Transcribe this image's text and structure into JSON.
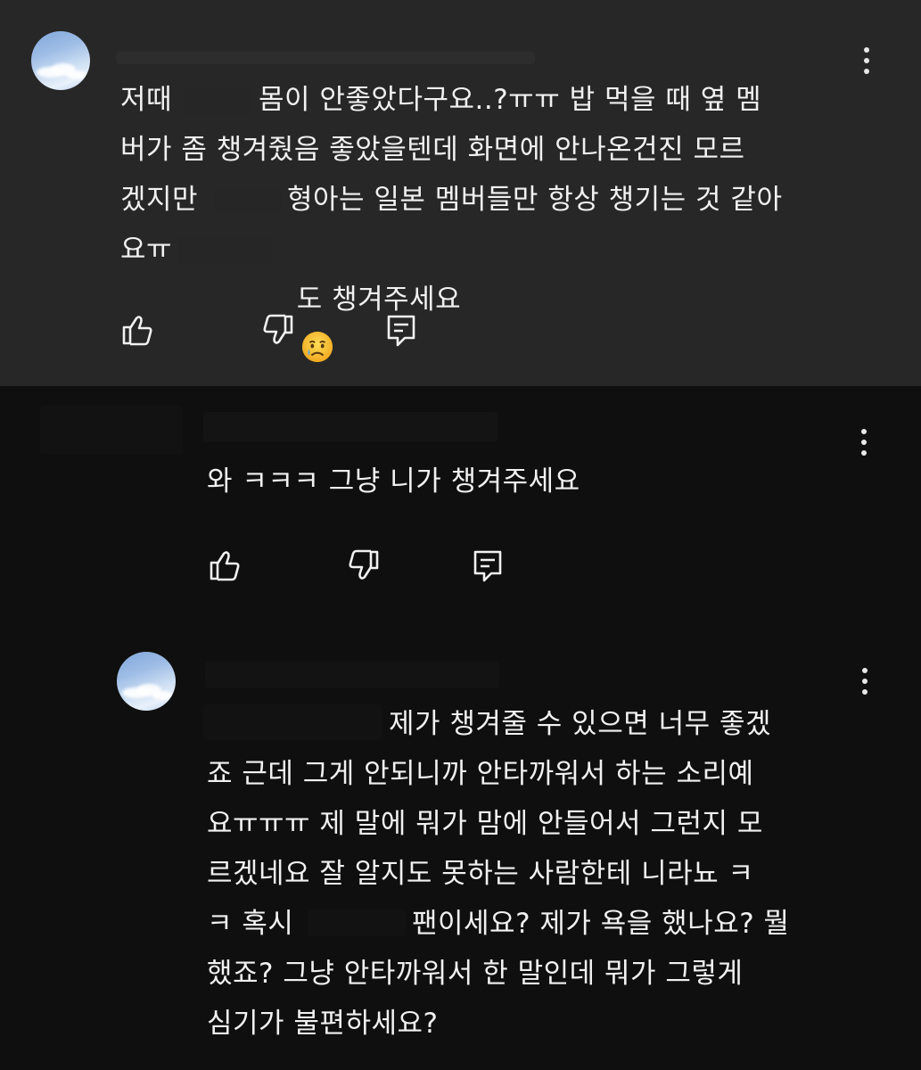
{
  "comment": {
    "text_line1_a": "저때",
    "text_line1_b": "몸이 안좋았다구요..?ㅠㅠ 밥 먹을 때 옆 멤",
    "text_line2": "버가 좀 챙겨줬음 좋았을텐데 화면에 안나온건진 모르",
    "text_line3_a": "겠지만",
    "text_line3_b": "형아는 일본 멤버들만 항상 챙기는 것 같아",
    "text_line4_a": "요ㅠ",
    "text_line4_b": "도 챙겨주세요",
    "emoji_icon": "crying-face-icon",
    "actions": [
      "like-icon",
      "dislike-icon",
      "reply-icon"
    ]
  },
  "reply1": {
    "text": "와 ㅋㅋㅋ 그냥 니가 챙겨주세요",
    "actions": [
      "like-icon",
      "dislike-icon",
      "reply-icon"
    ]
  },
  "reply2": {
    "text_line1": "제가 챙겨줄 수 있으면 너무 좋겠",
    "text_line2": "죠 근데 그게 안되니까 안타까워서 하는 소리예",
    "text_line3": "요ㅠㅠㅠ 제 말에 뭐가 맘에 안들어서 그런지 모",
    "text_line4": "르겠네요 잘 알지도 못하는 사람한테 니라뇨 ㅋ",
    "text_line5_a": "ㅋ 혹시",
    "text_line5_b": "팬이세요? 제가 욕을 했나요? 뭘",
    "text_line6": "했죠? 그냥 안타까워서 한 말인데 뭐가 그렇게",
    "text_line7": "심기가 불편하세요?"
  },
  "colors": {
    "highlight_bg": "#272727",
    "page_bg": "#0f0f0f",
    "text": "#f1f1f1"
  }
}
